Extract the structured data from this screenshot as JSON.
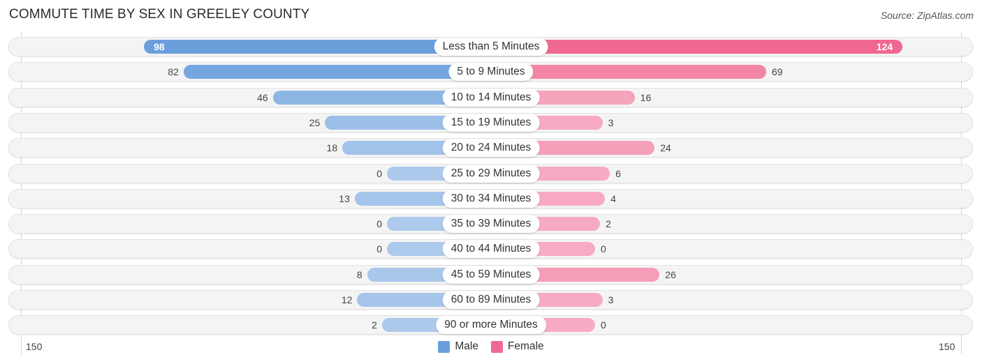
{
  "header": {
    "title": "COMMUTE TIME BY SEX IN GREELEY COUNTY",
    "source": "Source: ZipAtlas.com"
  },
  "legend": [
    {
      "label": "Male",
      "color": "#6a9fdc"
    },
    {
      "label": "Female",
      "color": "#f06891"
    }
  ],
  "axis": {
    "left_label": "150",
    "right_label": "150"
  },
  "chart_data": {
    "type": "bar",
    "orientation": "horizontal-diverging",
    "title": "COMMUTE TIME BY SEX IN GREELEY COUNTY",
    "xlabel": "",
    "ylabel": "",
    "xlim": [
      -150,
      150
    ],
    "axis_tick_labels": [
      "150",
      "150"
    ],
    "legend_position": "bottom-center",
    "grid": false,
    "categories": [
      "Less than 5 Minutes",
      "5 to 9 Minutes",
      "10 to 14 Minutes",
      "15 to 19 Minutes",
      "20 to 24 Minutes",
      "25 to 29 Minutes",
      "30 to 34 Minutes",
      "35 to 39 Minutes",
      "40 to 44 Minutes",
      "45 to 59 Minutes",
      "60 to 89 Minutes",
      "90 or more Minutes"
    ],
    "series": [
      {
        "name": "Male",
        "color": "#6a9fdc",
        "values": [
          98,
          82,
          46,
          25,
          18,
          0,
          13,
          0,
          0,
          8,
          12,
          2
        ]
      },
      {
        "name": "Female",
        "color": "#f06891",
        "values": [
          124,
          69,
          16,
          3,
          24,
          6,
          4,
          2,
          0,
          26,
          3,
          0
        ]
      }
    ]
  }
}
